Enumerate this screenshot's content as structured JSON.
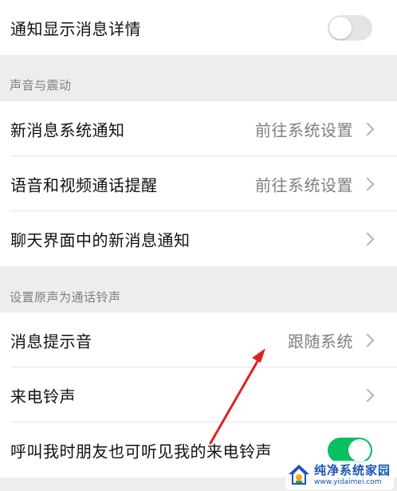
{
  "settings": {
    "show_details": {
      "label": "通知显示消息详情",
      "toggle": "off"
    },
    "sound_section": {
      "header": "声音与震动",
      "items": [
        {
          "label": "新消息系统通知",
          "value": "前往系统设置"
        },
        {
          "label": "语音和视频通话提醒",
          "value": "前往系统设置"
        },
        {
          "label": "聊天界面中的新消息通知",
          "value": ""
        }
      ]
    },
    "ringtone_section": {
      "header": "设置原声为通话铃声",
      "items": [
        {
          "label": "消息提示音",
          "value": "跟随系统"
        },
        {
          "label": "来电铃声",
          "value": ""
        }
      ],
      "friend_hear": {
        "label": "呼叫我时朋友也可听见我的来电铃声",
        "toggle": "on"
      }
    }
  },
  "colors": {
    "accent_green": "#07c160",
    "annotation_red": "#e02020",
    "background": "#ededed"
  },
  "watermark": {
    "title": "纯净系统家园",
    "url": "www.yidaimei.com",
    "icon": "house-logo-icon"
  }
}
